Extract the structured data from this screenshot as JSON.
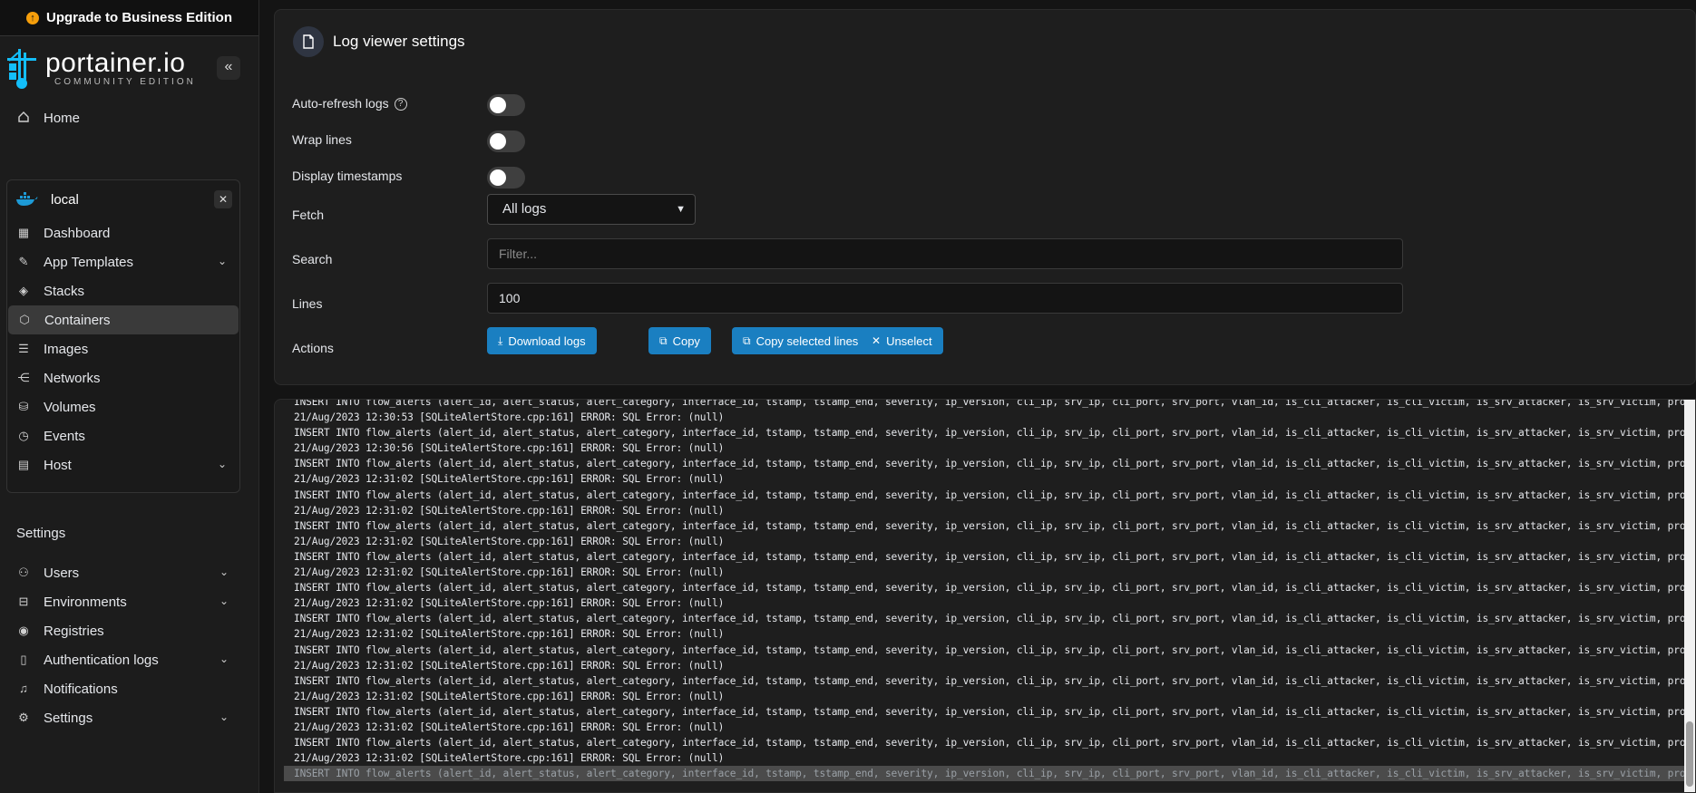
{
  "sidebar": {
    "upgrade_label": "Upgrade to Business Edition",
    "logo_main": "portainer.io",
    "logo_sub": "COMMUNITY EDITION",
    "collapse_glyph": "«",
    "home_label": "Home",
    "environment": {
      "name": "local",
      "items": [
        {
          "label": "Dashboard",
          "icon": "dashboard-icon"
        },
        {
          "label": "App Templates",
          "icon": "edit-icon",
          "chevron": true
        },
        {
          "label": "Stacks",
          "icon": "layers-icon"
        },
        {
          "label": "Containers",
          "icon": "box-icon",
          "active": true
        },
        {
          "label": "Images",
          "icon": "list-icon"
        },
        {
          "label": "Networks",
          "icon": "share-icon"
        },
        {
          "label": "Volumes",
          "icon": "database-icon"
        },
        {
          "label": "Events",
          "icon": "clock-icon"
        },
        {
          "label": "Host",
          "icon": "server-icon",
          "chevron": true
        }
      ]
    },
    "settings_heading": "Settings",
    "settings_items": [
      {
        "label": "Users",
        "icon": "users-icon",
        "chevron": true
      },
      {
        "label": "Environments",
        "icon": "drive-icon",
        "chevron": true
      },
      {
        "label": "Registries",
        "icon": "radio-icon"
      },
      {
        "label": "Authentication logs",
        "icon": "file-icon",
        "chevron": true
      },
      {
        "label": "Notifications",
        "icon": "bell-icon"
      },
      {
        "label": "Settings",
        "icon": "gear-icon",
        "chevron": true
      }
    ]
  },
  "panel": {
    "title": "Log viewer settings",
    "auto_refresh_label": "Auto-refresh logs",
    "wrap_lines_label": "Wrap lines",
    "timestamps_label": "Display timestamps",
    "fetch_label": "Fetch",
    "fetch_value": "All logs",
    "search_label": "Search",
    "search_placeholder": "Filter...",
    "lines_label": "Lines",
    "lines_value": "100",
    "actions_label": "Actions",
    "buttons": {
      "download": "Download logs",
      "copy": "Copy",
      "copy_selected": "Copy selected lines",
      "unselect": "Unselect"
    }
  },
  "logs": {
    "insert_line": "INSERT INTO flow_alerts (alert_id, alert_status, alert_category, interface_id, tstamp, tstamp_end, severity, ip_version, cli_ip, srv_ip, cli_port, srv_port, vlan_id, is_cli_attacker, is_cli_victim, is_srv_attacker, is_srv_victim, proto",
    "lines": [
      "INSERT INTO flow_alerts (alert_id, alert_status, alert_category, interface_id, tstamp, tstamp_end, severity, ip_version, cli_ip, srv_ip, cli_port, srv_port, vlan_id, is_cli_attacker, is_cli_victim, is_srv_attacker, is_srv_victim, proto",
      "21/Aug/2023 12:30:53 [SQLiteAlertStore.cpp:161] ERROR: SQL Error: (null)",
      "INSERT INTO flow_alerts (alert_id, alert_status, alert_category, interface_id, tstamp, tstamp_end, severity, ip_version, cli_ip, srv_ip, cli_port, srv_port, vlan_id, is_cli_attacker, is_cli_victim, is_srv_attacker, is_srv_victim, proto",
      "21/Aug/2023 12:30:56 [SQLiteAlertStore.cpp:161] ERROR: SQL Error: (null)",
      "INSERT INTO flow_alerts (alert_id, alert_status, alert_category, interface_id, tstamp, tstamp_end, severity, ip_version, cli_ip, srv_ip, cli_port, srv_port, vlan_id, is_cli_attacker, is_cli_victim, is_srv_attacker, is_srv_victim, proto",
      "21/Aug/2023 12:31:02 [SQLiteAlertStore.cpp:161] ERROR: SQL Error: (null)",
      "INSERT INTO flow_alerts (alert_id, alert_status, alert_category, interface_id, tstamp, tstamp_end, severity, ip_version, cli_ip, srv_ip, cli_port, srv_port, vlan_id, is_cli_attacker, is_cli_victim, is_srv_attacker, is_srv_victim, proto",
      "21/Aug/2023 12:31:02 [SQLiteAlertStore.cpp:161] ERROR: SQL Error: (null)",
      "INSERT INTO flow_alerts (alert_id, alert_status, alert_category, interface_id, tstamp, tstamp_end, severity, ip_version, cli_ip, srv_ip, cli_port, srv_port, vlan_id, is_cli_attacker, is_cli_victim, is_srv_attacker, is_srv_victim, proto",
      "21/Aug/2023 12:31:02 [SQLiteAlertStore.cpp:161] ERROR: SQL Error: (null)",
      "INSERT INTO flow_alerts (alert_id, alert_status, alert_category, interface_id, tstamp, tstamp_end, severity, ip_version, cli_ip, srv_ip, cli_port, srv_port, vlan_id, is_cli_attacker, is_cli_victim, is_srv_attacker, is_srv_victim, proto",
      "21/Aug/2023 12:31:02 [SQLiteAlertStore.cpp:161] ERROR: SQL Error: (null)",
      "INSERT INTO flow_alerts (alert_id, alert_status, alert_category, interface_id, tstamp, tstamp_end, severity, ip_version, cli_ip, srv_ip, cli_port, srv_port, vlan_id, is_cli_attacker, is_cli_victim, is_srv_attacker, is_srv_victim, proto",
      "21/Aug/2023 12:31:02 [SQLiteAlertStore.cpp:161] ERROR: SQL Error: (null)",
      "INSERT INTO flow_alerts (alert_id, alert_status, alert_category, interface_id, tstamp, tstamp_end, severity, ip_version, cli_ip, srv_ip, cli_port, srv_port, vlan_id, is_cli_attacker, is_cli_victim, is_srv_attacker, is_srv_victim, proto",
      "21/Aug/2023 12:31:02 [SQLiteAlertStore.cpp:161] ERROR: SQL Error: (null)",
      "INSERT INTO flow_alerts (alert_id, alert_status, alert_category, interface_id, tstamp, tstamp_end, severity, ip_version, cli_ip, srv_ip, cli_port, srv_port, vlan_id, is_cli_attacker, is_cli_victim, is_srv_attacker, is_srv_victim, proto",
      "21/Aug/2023 12:31:02 [SQLiteAlertStore.cpp:161] ERROR: SQL Error: (null)",
      "INSERT INTO flow_alerts (alert_id, alert_status, alert_category, interface_id, tstamp, tstamp_end, severity, ip_version, cli_ip, srv_ip, cli_port, srv_port, vlan_id, is_cli_attacker, is_cli_victim, is_srv_attacker, is_srv_victim, proto",
      "21/Aug/2023 12:31:02 [SQLiteAlertStore.cpp:161] ERROR: SQL Error: (null)",
      "INSERT INTO flow_alerts (alert_id, alert_status, alert_category, interface_id, tstamp, tstamp_end, severity, ip_version, cli_ip, srv_ip, cli_port, srv_port, vlan_id, is_cli_attacker, is_cli_victim, is_srv_attacker, is_srv_victim, proto",
      "21/Aug/2023 12:31:02 [SQLiteAlertStore.cpp:161] ERROR: SQL Error: (null)",
      "INSERT INTO flow_alerts (alert_id, alert_status, alert_category, interface_id, tstamp, tstamp_end, severity, ip_version, cli_ip, srv_ip, cli_port, srv_port, vlan_id, is_cli_attacker, is_cli_victim, is_srv_attacker, is_srv_victim, proto",
      "21/Aug/2023 12:31:02 [SQLiteAlertStore.cpp:161] ERROR: SQL Error: (null)",
      "INSERT INTO flow_alerts (alert_id, alert_status, alert_category, interface_id, tstamp, tstamp_end, severity, ip_version, cli_ip, srv_ip, cli_port, srv_port, vlan_id, is_cli_attacker, is_cli_victim, is_srv_attacker, is_srv_victim, proto"
    ],
    "selected_index": 24
  },
  "colors": {
    "accent": "#1a7fc1",
    "sidebar_bg": "#1c1c1c",
    "panel_bg": "#1e1e1e",
    "docker_blue": "#1d9ad6"
  }
}
